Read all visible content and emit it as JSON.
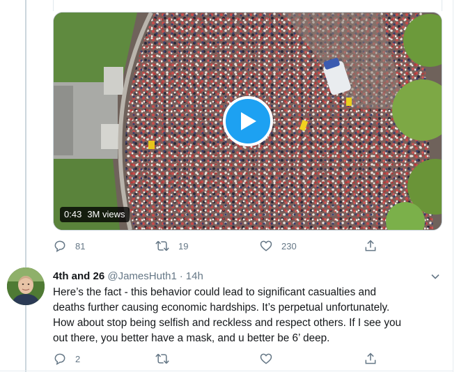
{
  "colors": {
    "accent": "#1da1f2",
    "text": "#14171a",
    "muted": "#657786",
    "line": "#ccd6dd"
  },
  "video": {
    "duration": "0:43",
    "views": "3M views",
    "play_icon": "play-icon"
  },
  "first_tweet_actions": {
    "reply_count": "81",
    "retweet_count": "19",
    "like_count": "230"
  },
  "reply_tweet": {
    "display_name": "4th and 26",
    "handle": "@JamesHuth1",
    "dot": "·",
    "time": "14h",
    "text_lines": [
      "Here’s the fact - this behavior could lead to significant casualties and",
      "deaths further causing economic hardships. It’s perpetual unfortunately.",
      "How about stop being selfish and reckless and respect others. If I see you",
      "out there, you better have a mask, and u better be 6’ deep."
    ],
    "actions": {
      "reply_count": "2",
      "retweet_count": "",
      "like_count": ""
    }
  }
}
